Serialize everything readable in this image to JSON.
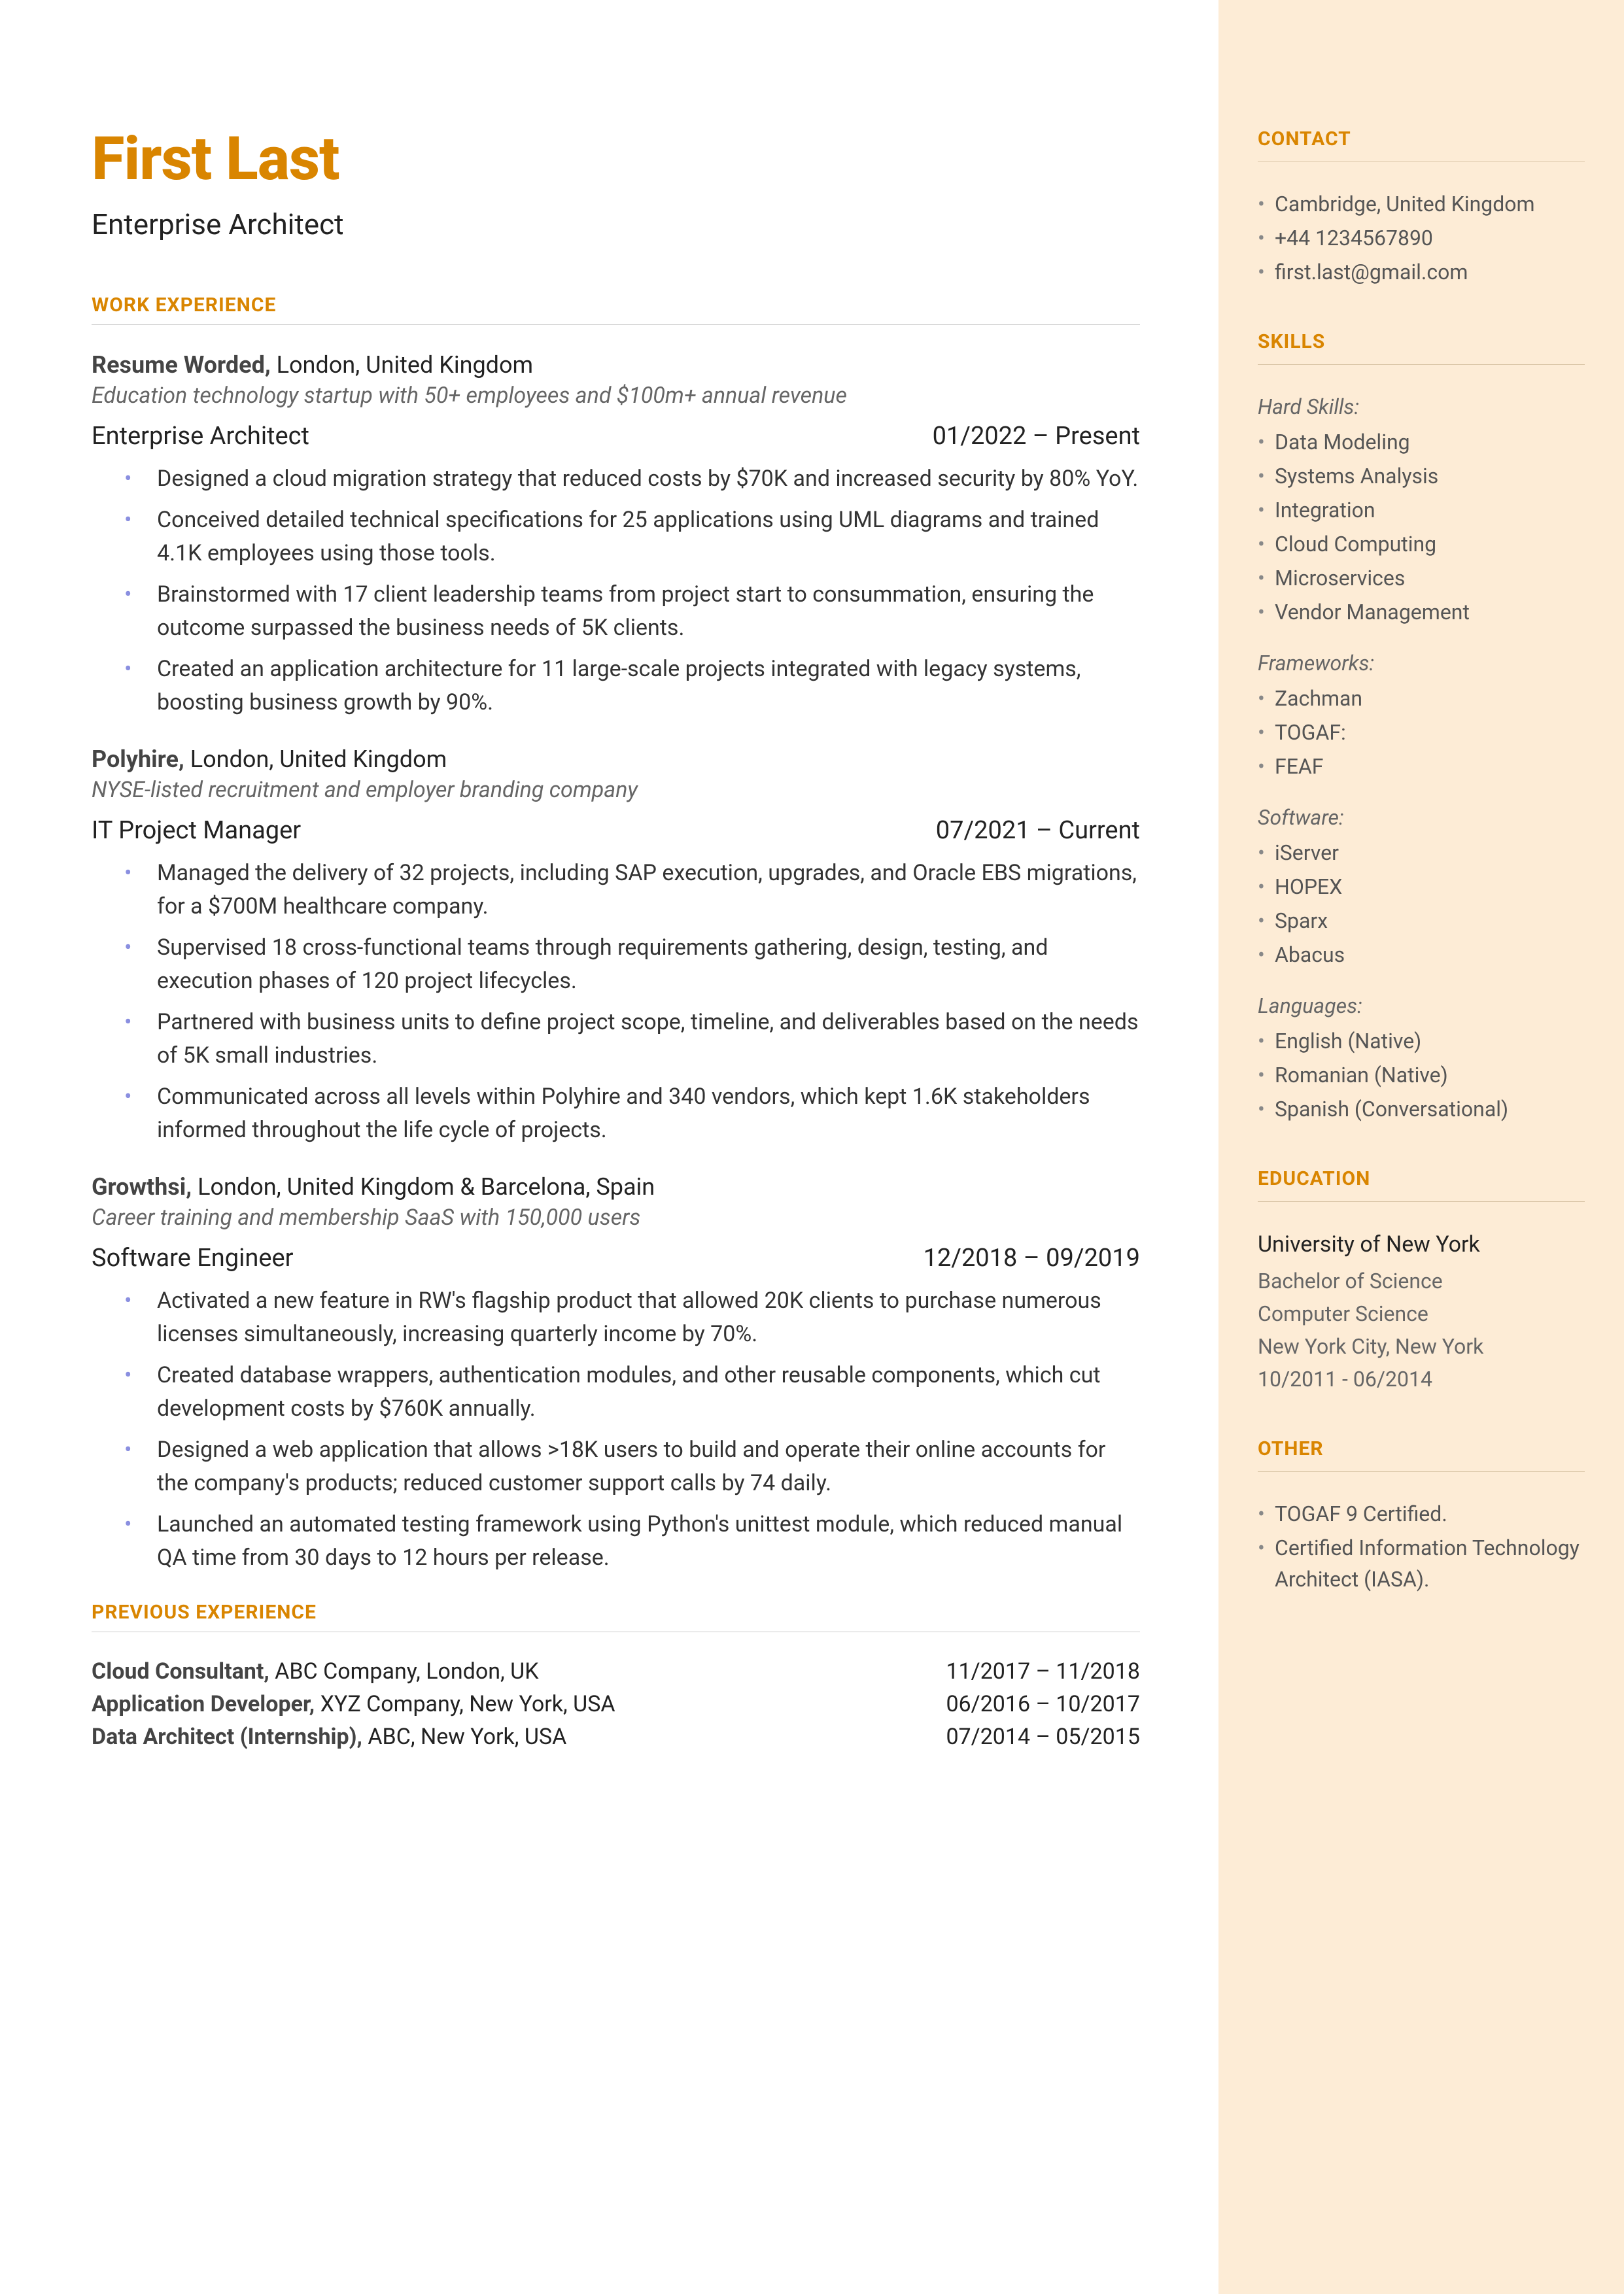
{
  "header": {
    "name": "First Last",
    "title": "Enterprise Architect"
  },
  "sections": {
    "work": "WORK EXPERIENCE",
    "previous": "PREVIOUS EXPERIENCE",
    "contact": "CONTACT",
    "skills": "SKILLS",
    "education": "EDUCATION",
    "other": "OTHER"
  },
  "experience": [
    {
      "company": "Resume Worded,",
      "location": " London, United Kingdom",
      "desc": "Education technology startup with 50+ employees and $100m+ annual revenue",
      "role": "Enterprise Architect",
      "dates": "01/2022 – Present",
      "bullets": [
        "Designed a cloud migration strategy that reduced costs by $70K and increased security by 80% YoY.",
        "Conceived detailed technical specifications for 25 applications using UML diagrams and trained 4.1K employees using those tools.",
        "Brainstormed with 17 client leadership teams from project start to consummation, ensuring the outcome surpassed the business needs of 5K clients.",
        "Created an application architecture for 11 large-scale projects integrated with legacy systems, boosting business growth by 90%."
      ]
    },
    {
      "company": "Polyhire,",
      "location": " London, United Kingdom",
      "desc": "NYSE-listed recruitment and employer branding company",
      "role": "IT Project Manager",
      "dates": "07/2021 – Current",
      "bullets": [
        "Managed the delivery of 32 projects, including SAP execution, upgrades, and Oracle EBS migrations, for a $700M healthcare company.",
        "Supervised 18 cross-functional teams through requirements gathering, design, testing, and execution phases of 120 project lifecycles.",
        "Partnered with business units to define project scope, timeline, and deliverables based on the needs of 5K small industries.",
        "Communicated across all levels within Polyhire and 340 vendors, which kept 1.6K stakeholders informed throughout the life cycle of projects."
      ]
    },
    {
      "company": "Growthsi,",
      "location": " London, United Kingdom & Barcelona, Spain",
      "desc": "Career training and membership SaaS with 150,000 users",
      "role": "Software Engineer",
      "dates": "12/2018 – 09/2019",
      "bullets": [
        "Activated a new feature in RW's flagship product that allowed 20K clients to purchase numerous licenses simultaneously, increasing quarterly income by 70%.",
        "Created database wrappers, authentication modules, and other reusable components, which cut development costs by $760K annually.",
        "Designed a web application that allows >18K users to build and operate their online accounts for the company's products; reduced customer support calls by 74 daily.",
        "Launched an automated testing framework using Python's unittest module, which reduced manual QA time from 30 days to 12 hours per release."
      ]
    }
  ],
  "previous": [
    {
      "title": "Cloud Consultant,",
      "rest": " ABC Company, London, UK",
      "dates": "11/2017 – 11/2018"
    },
    {
      "title": "Application Developer,",
      "rest": " XYZ Company, New York, USA",
      "dates": "06/2016 – 10/2017"
    },
    {
      "title": "Data Architect (Internship),",
      "rest": " ABC, New York, USA",
      "dates": "07/2014 – 05/2015"
    }
  ],
  "contact": [
    "Cambridge, United Kingdom",
    "+44 1234567890",
    "first.last@gmail.com"
  ],
  "skills": {
    "hard_label": "Hard Skills:",
    "hard": [
      "Data Modeling",
      "Systems Analysis",
      "Integration",
      "Cloud Computing",
      "Microservices",
      "Vendor Management"
    ],
    "frameworks_label": "Frameworks:",
    "frameworks": [
      "Zachman",
      "TOGAF:",
      "FEAF"
    ],
    "software_label": "Software:",
    "software": [
      "iServer",
      "HOPEX",
      "Sparx",
      "Abacus"
    ],
    "languages_label": "Languages:",
    "languages": [
      "English (Native)",
      "Romanian (Native)",
      "Spanish (Conversational)"
    ]
  },
  "education": {
    "school": "University of New York",
    "degree": "Bachelor of Science",
    "field": "Computer Science",
    "location": "New York City, New York",
    "dates": "10/2011 - 06/2014"
  },
  "other": [
    "TOGAF 9 Certified.",
    "Certified Information Technology Architect (IASA)."
  ]
}
